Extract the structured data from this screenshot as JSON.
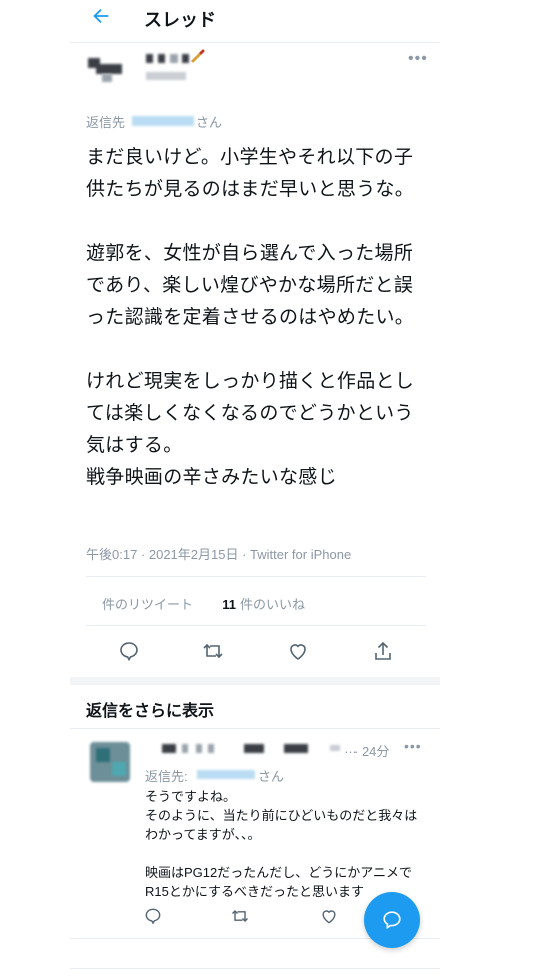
{
  "header": {
    "title": "スレッド",
    "back_icon": "arrow-left-icon"
  },
  "tweet": {
    "reply_to_prefix": "返信先",
    "reply_to_suffix": "さん",
    "text": "まだ良いけど。小学生やそれ以下の子供たちが見るのはまだ早いと思うな。\n\n遊郭を、女性が自ら選んで入った場所であり、楽しい煌びやかな場所だと誤った認識を定着させるのはやめたい。\n\nけれど現実をしっかり描くと作品としては楽しくなくなるのでどうかという気はする。\n戦争映画の辛さみたいな感じ",
    "timestamp": "午後0:17 · 2021年2月15日 · Twitter for iPhone",
    "retweets_label": "件のリツイート",
    "likes_count": "11",
    "likes_label": "件のいいね",
    "more": "•••"
  },
  "actions": [
    "reply-icon",
    "retweet-icon",
    "like-icon",
    "share-icon"
  ],
  "more_replies": {
    "title": "返信をさらに表示"
  },
  "reply": {
    "ellipsis": "…",
    "time": "· 24分",
    "reply_to_prefix": "返信先:",
    "reply_to_suffix": "さん",
    "text": "そうですよね。\nそのように、当たり前にひどいものだと我々はわかってますが、、。\n\n映画はPG12だったんだし、どうにかアニメでR15とかにするべきだったと思います",
    "more": "•••"
  },
  "colors": {
    "accent": "#1d9bf0",
    "muted": "#8b98a5",
    "text": "#0f1419"
  }
}
